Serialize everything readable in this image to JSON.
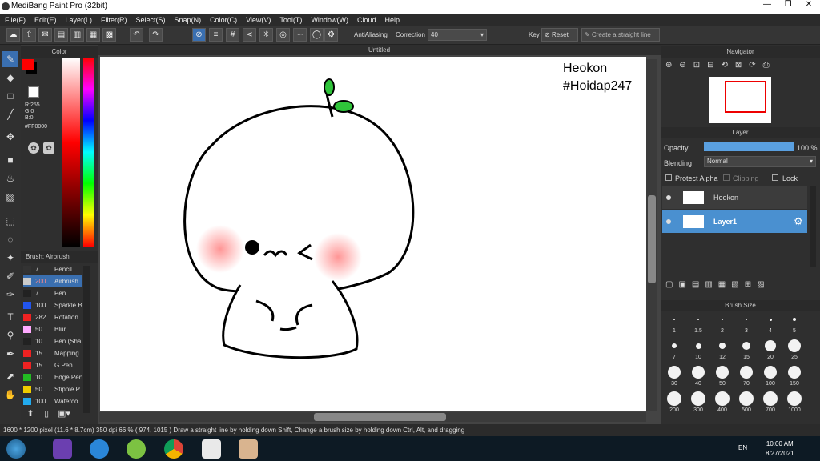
{
  "app": {
    "title": "MediBang Paint Pro (32bit)"
  },
  "menu": [
    "File(F)",
    "Edit(E)",
    "Layer(L)",
    "Filter(R)",
    "Select(S)",
    "Snap(N)",
    "Color(C)",
    "View(V)",
    "Tool(T)",
    "Window(W)",
    "Cloud",
    "Help"
  ],
  "toolbar": {
    "antialias_label": "AntiAliasing",
    "correction_label": "Correction",
    "correction_value": "40",
    "key_label": "Key",
    "reset_label": "Reset",
    "straight_label": "Create a straight line"
  },
  "color_panel": {
    "title": "Color",
    "r": "R:255",
    "g": "G:0",
    "b": "B:0",
    "hex": "#FF0000",
    "fg_color": "#FF0000"
  },
  "brush_panel": {
    "title": "Brush: Airbrush",
    "items": [
      {
        "size": "7",
        "name": "Pencil",
        "color": "#333333"
      },
      {
        "size": "200",
        "name": "Airbrush",
        "color": "#cccccc"
      },
      {
        "size": "7",
        "name": "Pen",
        "color": "#222222"
      },
      {
        "size": "100",
        "name": "Sparkle B",
        "color": "#2255ee"
      },
      {
        "size": "282",
        "name": "Rotation",
        "color": "#ee2222"
      },
      {
        "size": "50",
        "name": "Blur",
        "color": "#ffaaff"
      },
      {
        "size": "10",
        "name": "Pen (Sha",
        "color": "#222222"
      },
      {
        "size": "15",
        "name": "Mapping",
        "color": "#ee2222"
      },
      {
        "size": "15",
        "name": "G Pen",
        "color": "#ee2222"
      },
      {
        "size": "10",
        "name": "Edge Pen",
        "color": "#22bb22"
      },
      {
        "size": "50",
        "name": "Stipple P",
        "color": "#eecc00"
      },
      {
        "size": "100",
        "name": "Waterco",
        "color": "#22aaee"
      }
    ]
  },
  "canvas": {
    "tab_title": "Untitled",
    "text_line1": "Heokon",
    "text_line2": "#Hoidap247"
  },
  "navigator": {
    "title": "Navigator"
  },
  "layer_panel": {
    "title": "Layer",
    "opacity_label": "Opacity",
    "opacity_value": "100 %",
    "opacity_level": 1.0,
    "blending_label": "Blending",
    "blending_value": "Normal",
    "protect_alpha": "Protect Alpha",
    "clipping": "Clipping",
    "lock": "Lock",
    "layers": [
      {
        "name": "Heokon"
      },
      {
        "name": "Layer1"
      }
    ]
  },
  "brush_size": {
    "title": "Brush Size",
    "sizes": [
      "1",
      "1.5",
      "2",
      "3",
      "4",
      "5",
      "7",
      "10",
      "12",
      "15",
      "20",
      "25",
      "30",
      "40",
      "50",
      "70",
      "100",
      "150",
      "200",
      "300",
      "400",
      "500",
      "700",
      "1000"
    ]
  },
  "status": {
    "text": "1600 * 1200 pixel   (11.6 * 8.7cm)   350 dpi   66 %   ( 974, 1015 )   Draw a straight line by holding down Shift, Change a brush size by holding down Ctrl, Alt, and dragging"
  },
  "taskbar": {
    "lang": "EN",
    "time": "10:00 AM",
    "date": "8/27/2021"
  }
}
